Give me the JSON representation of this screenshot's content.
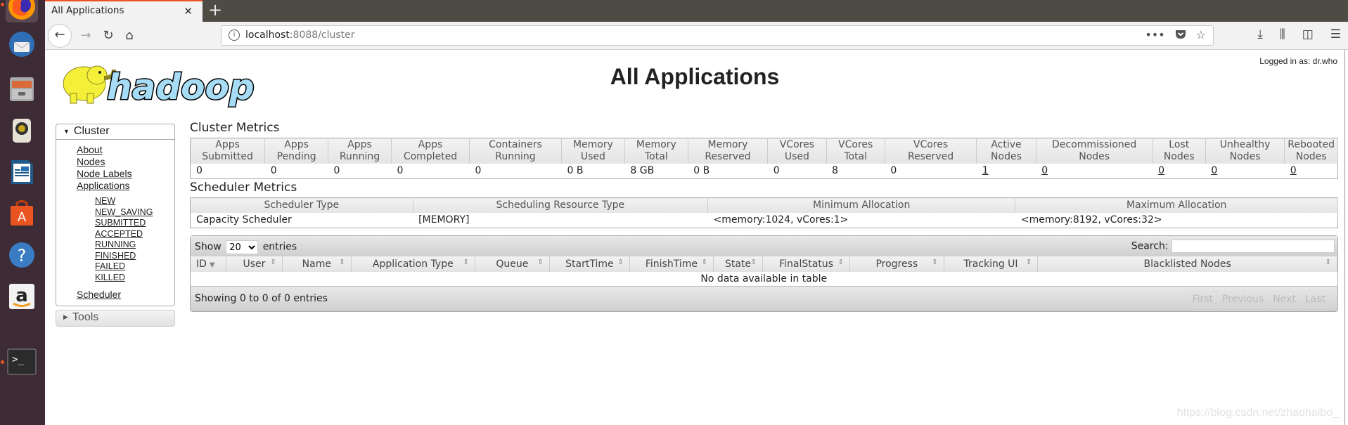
{
  "dock": {
    "items": [
      {
        "name": "firefox-icon",
        "active": true
      },
      {
        "name": "thunderbird-icon"
      },
      {
        "name": "files-icon"
      },
      {
        "name": "rhythmbox-icon"
      },
      {
        "name": "libreoffice-writer-icon"
      },
      {
        "name": "software-center-icon"
      },
      {
        "name": "help-icon"
      },
      {
        "name": "amazon-icon"
      },
      {
        "name": "terminal-icon",
        "running": true
      }
    ]
  },
  "browser": {
    "tab_title": "All Applications",
    "tab_close": "✕",
    "new_tab": "+",
    "url_host": "localhost",
    "url_rest": ":8088/cluster",
    "page_actions": "•••"
  },
  "page": {
    "logged_in": "Logged in as: dr.who",
    "logo_text": "hadoop",
    "title": "All Applications",
    "watermark": "https://blog.csdn.net/zhaohaibo_"
  },
  "sidebar": {
    "cluster_label": "Cluster",
    "cluster_links": [
      "About",
      "Nodes",
      "Node Labels",
      "Applications"
    ],
    "app_states": [
      "NEW",
      "NEW_SAVING",
      "SUBMITTED",
      "ACCEPTED",
      "RUNNING",
      "FINISHED",
      "FAILED",
      "KILLED"
    ],
    "scheduler_label": "Scheduler",
    "tools_label": "Tools"
  },
  "cluster_metrics": {
    "heading": "Cluster Metrics",
    "columns": [
      {
        "h1": "Apps",
        "h2": "Submitted",
        "value": "0",
        "link": false
      },
      {
        "h1": "Apps",
        "h2": "Pending",
        "value": "0",
        "link": false
      },
      {
        "h1": "Apps",
        "h2": "Running",
        "value": "0",
        "link": false
      },
      {
        "h1": "Apps",
        "h2": "Completed",
        "value": "0",
        "link": false
      },
      {
        "h1": "Containers",
        "h2": "Running",
        "value": "0",
        "link": false
      },
      {
        "h1": "Memory",
        "h2": "Used",
        "value": "0 B",
        "link": false
      },
      {
        "h1": "Memory",
        "h2": "Total",
        "value": "8 GB",
        "link": false
      },
      {
        "h1": "Memory",
        "h2": "Reserved",
        "value": "0 B",
        "link": false
      },
      {
        "h1": "VCores",
        "h2": "Used",
        "value": "0",
        "link": false
      },
      {
        "h1": "VCores",
        "h2": "Total",
        "value": "8",
        "link": false
      },
      {
        "h1": "VCores",
        "h2": "Reserved",
        "value": "0",
        "link": false
      },
      {
        "h1": "Active",
        "h2": "Nodes",
        "value": "1",
        "link": true
      },
      {
        "h1": "Decommissioned",
        "h2": "Nodes",
        "value": "0",
        "link": true
      },
      {
        "h1": "Lost",
        "h2": "Nodes",
        "value": "0",
        "link": true
      },
      {
        "h1": "Unhealthy",
        "h2": "Nodes",
        "value": "0",
        "link": true
      },
      {
        "h1": "Rebooted",
        "h2": "Nodes",
        "value": "0",
        "link": true
      }
    ]
  },
  "scheduler_metrics": {
    "heading": "Scheduler Metrics",
    "headers": [
      "Scheduler Type",
      "Scheduling Resource Type",
      "Minimum Allocation",
      "Maximum Allocation"
    ],
    "row": [
      "Capacity Scheduler",
      "[MEMORY]",
      "<memory:1024, vCores:1>",
      "<memory:8192, vCores:32>"
    ]
  },
  "apps_table": {
    "show_label": "Show",
    "page_size": "20",
    "entries_label": "entries",
    "search_label": "Search:",
    "search_value": "",
    "columns": [
      "ID",
      "User",
      "Name",
      "Application Type",
      "Queue",
      "StartTime",
      "FinishTime",
      "State",
      "FinalStatus",
      "Progress",
      "Tracking UI",
      "Blacklisted Nodes"
    ],
    "empty_message": "No data available in table",
    "info": "Showing 0 to 0 of 0 entries",
    "pager": [
      "First",
      "Previous",
      "Next",
      "Last"
    ]
  }
}
